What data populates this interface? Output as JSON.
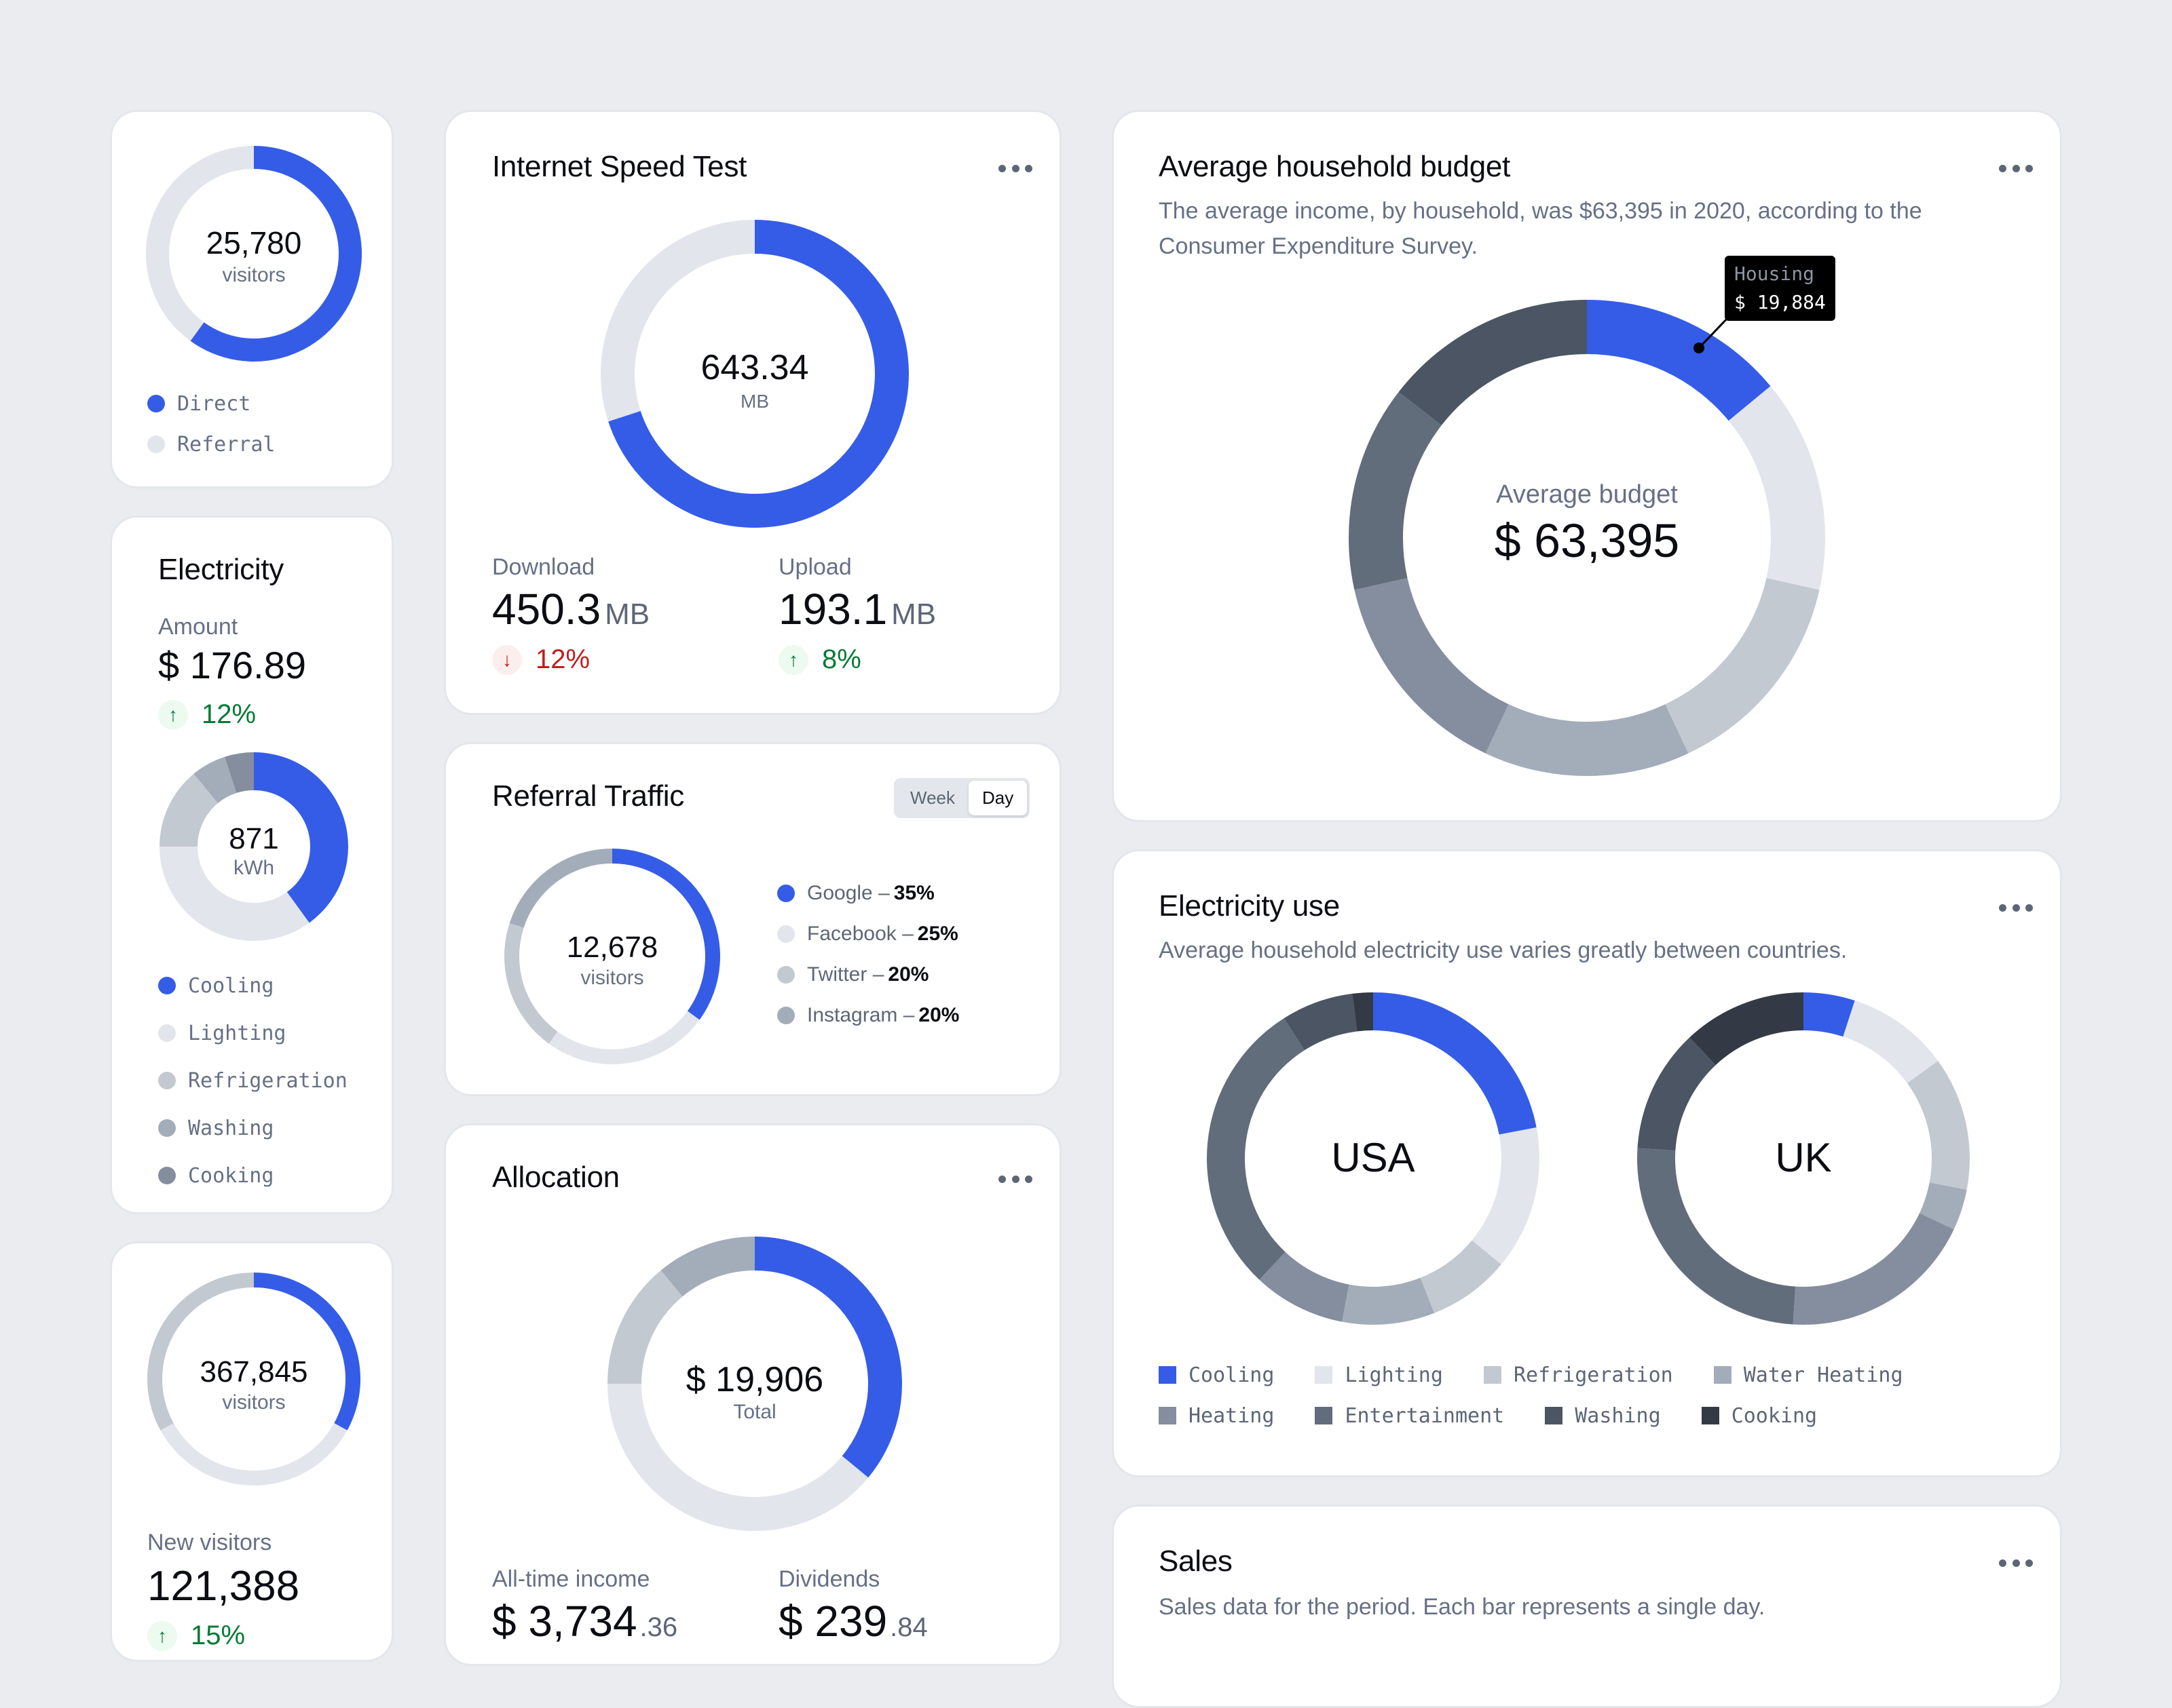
{
  "colors": {
    "accent": "#355ce7",
    "g1": "#e2e5ec",
    "g2": "#c3c9d1",
    "g3": "#a3acb9",
    "g4": "#858e9e",
    "g5": "#626d7b",
    "g6": "#4b5563",
    "g7": "#343a45",
    "positive": "#067a35",
    "negative": "#c01e1e"
  },
  "visitors_card": {
    "value": "25,780",
    "unit": "visitors",
    "legend": [
      "Direct",
      "Referral"
    ]
  },
  "electricity_card": {
    "title": "Electricity",
    "amount_label": "Amount",
    "amount": "$ 176.89",
    "trend": {
      "direction": "up",
      "icon": "arrow-up-icon",
      "value": "12%"
    },
    "center_value": "871",
    "center_unit": "kWh",
    "legend": [
      "Cooling",
      "Lighting",
      "Refrigeration",
      "Washing",
      "Cooking"
    ]
  },
  "new_visitors_card": {
    "value": "367,845",
    "unit": "visitors",
    "stat_label": "New visitors",
    "stat_value": "121,388",
    "trend": {
      "direction": "up",
      "icon": "arrow-up-icon",
      "value": "15%"
    }
  },
  "speed_card": {
    "title": "Internet Speed Test",
    "menu_icon": "more-horizontal-icon",
    "center_value": "643.34",
    "center_unit": "MB",
    "download": {
      "label": "Download",
      "value": "450.3",
      "unit": "MB",
      "trend": {
        "direction": "down",
        "icon": "arrow-down-icon",
        "value": "12%"
      }
    },
    "upload": {
      "label": "Upload",
      "value": "193.1",
      "unit": "MB",
      "trend": {
        "direction": "up",
        "icon": "arrow-up-icon",
        "value": "8%"
      }
    }
  },
  "referral_card": {
    "title": "Referral Traffic",
    "toggle": {
      "options": [
        "Week",
        "Day"
      ],
      "selected": "Day"
    },
    "center_value": "12,678",
    "center_unit": "visitors",
    "legend": [
      {
        "name": "Google",
        "pct": "35%"
      },
      {
        "name": "Facebook",
        "pct": "25%"
      },
      {
        "name": "Twitter",
        "pct": "20%"
      },
      {
        "name": "Instagram",
        "pct": "20%"
      }
    ]
  },
  "allocation_card": {
    "title": "Allocation",
    "menu_icon": "more-horizontal-icon",
    "center_value": "$ 19,906",
    "center_unit": "Total",
    "income": {
      "label": "All-time income",
      "value": "$ 3,734",
      "cents": ".36"
    },
    "dividends": {
      "label": "Dividends",
      "value": "$ 239",
      "cents": ".84"
    }
  },
  "budget_card": {
    "title": "Average household budget",
    "menu_icon": "more-horizontal-icon",
    "description": "The average income, by household, was $63,395 in 2020, according to the Consumer Expenditure Survey.",
    "center_label": "Average budget",
    "center_value": "$ 63,395",
    "tooltip": {
      "label": "Housing",
      "value": "$ 19,884"
    }
  },
  "electricity_use_card": {
    "title": "Electricity use",
    "menu_icon": "more-horizontal-icon",
    "description": "Average household electricity use varies greatly between countries.",
    "legend": [
      "Cooling",
      "Lighting",
      "Refrigeration",
      "Water Heating",
      "Heating",
      "Entertainment",
      "Washing",
      "Cooking"
    ]
  },
  "sales_card": {
    "title": "Sales",
    "menu_icon": "more-horizontal-icon",
    "description": "Sales data for the period. Each bar represents a single day."
  },
  "chart_data": [
    {
      "id": "visitors",
      "type": "pie",
      "title": "25,780 visitors",
      "categories": [
        "Direct",
        "Referral"
      ],
      "values": [
        60,
        40
      ],
      "colors": [
        "#355ce7",
        "#e2e5ec"
      ]
    },
    {
      "id": "electricity",
      "type": "pie",
      "title": "871 kWh",
      "categories": [
        "Cooling",
        "Lighting",
        "Refrigeration",
        "Washing",
        "Cooking"
      ],
      "values": [
        40,
        35,
        14,
        6,
        5
      ],
      "colors": [
        "#355ce7",
        "#e2e5ec",
        "#c3c9d1",
        "#a3acb9",
        "#858e9e"
      ]
    },
    {
      "id": "new_visitors",
      "type": "pie",
      "title": "367,845 visitors",
      "categories": [
        "Segment 1",
        "Segment 2",
        "Segment 3"
      ],
      "values": [
        33,
        34,
        33
      ],
      "colors": [
        "#355ce7",
        "#e2e5ec",
        "#c3c9d1"
      ]
    },
    {
      "id": "speed",
      "type": "pie",
      "title": "643.34 MB",
      "categories": [
        "Download",
        "Upload"
      ],
      "values": [
        450.3,
        193.1
      ],
      "colors": [
        "#355ce7",
        "#e2e5ec"
      ]
    },
    {
      "id": "referral",
      "type": "pie",
      "title": "12,678 visitors",
      "categories": [
        "Google",
        "Facebook",
        "Twitter",
        "Instagram"
      ],
      "values": [
        35,
        25,
        20,
        20
      ],
      "colors": [
        "#355ce7",
        "#e2e5ec",
        "#c3c9d1",
        "#a3acb9"
      ]
    },
    {
      "id": "allocation",
      "type": "pie",
      "title": "$ 19,906 Total",
      "categories": [
        "Segment 1",
        "Segment 2",
        "Segment 3",
        "Segment 4"
      ],
      "values": [
        36,
        39,
        14,
        11
      ],
      "colors": [
        "#355ce7",
        "#e2e5ec",
        "#c3c9d1",
        "#a3acb9"
      ]
    },
    {
      "id": "budget",
      "type": "pie",
      "title": "Average budget $ 63,395",
      "categories": [
        "Housing",
        "Segment 2",
        "Segment 3",
        "Segment 4",
        "Segment 5",
        "Segment 6",
        "Segment 7"
      ],
      "values": [
        14,
        14.5,
        14.5,
        14,
        14.5,
        14,
        14.5
      ],
      "colors": [
        "#355ce7",
        "#e2e5ec",
        "#c3c9d1",
        "#a3acb9",
        "#858e9e",
        "#626d7b",
        "#4b5563"
      ],
      "annotation": {
        "category": "Housing",
        "value": "$ 19,884"
      }
    },
    {
      "id": "usa",
      "type": "pie",
      "title": "USA",
      "categories": [
        "Cooling",
        "Lighting",
        "Refrigeration",
        "Water Heating",
        "Heating",
        "Entertainment",
        "Washing",
        "Cooking"
      ],
      "values": [
        22,
        14,
        8,
        9,
        9,
        29,
        7,
        2
      ],
      "colors": [
        "#355ce7",
        "#e2e5ec",
        "#c3c9d1",
        "#a3acb9",
        "#858e9e",
        "#626d7b",
        "#4b5563",
        "#343a45"
      ]
    },
    {
      "id": "uk",
      "type": "pie",
      "title": "UK",
      "categories": [
        "Cooling",
        "Lighting",
        "Refrigeration",
        "Water Heating",
        "Heating",
        "Entertainment",
        "Washing",
        "Cooking"
      ],
      "values": [
        5,
        10,
        13,
        4,
        19,
        25,
        12,
        12
      ],
      "colors": [
        "#355ce7",
        "#e2e5ec",
        "#c3c9d1",
        "#a3acb9",
        "#858e9e",
        "#626d7b",
        "#4b5563",
        "#343a45"
      ]
    }
  ]
}
